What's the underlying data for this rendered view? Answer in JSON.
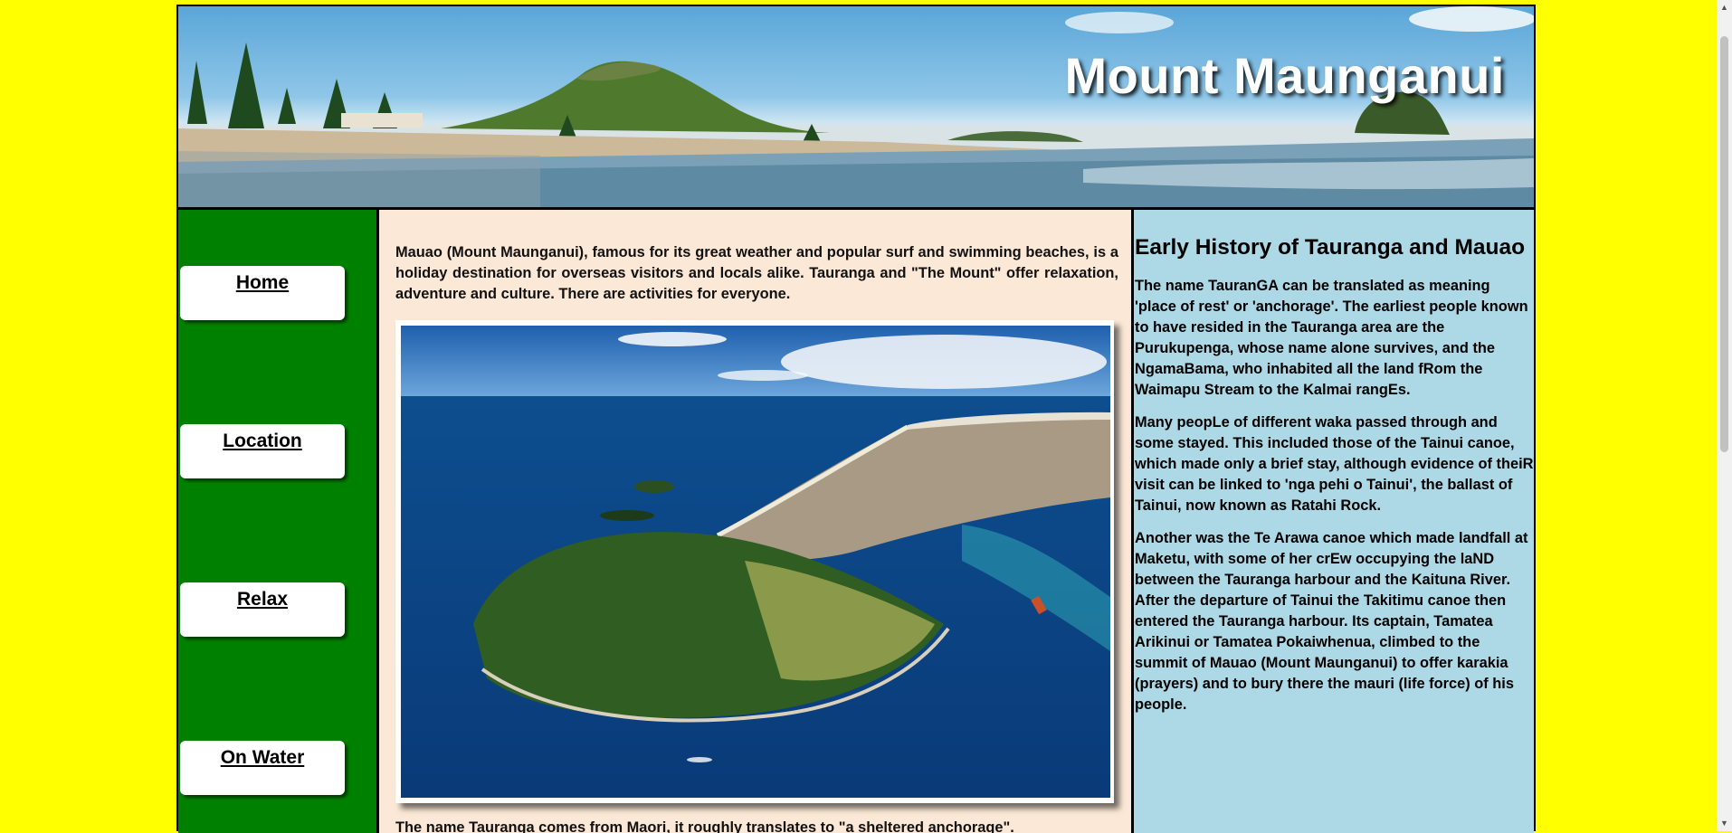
{
  "header": {
    "title": "Mount Maunganui"
  },
  "nav": {
    "items": [
      {
        "label": "Home"
      },
      {
        "label": "Location"
      },
      {
        "label": "Relax"
      },
      {
        "label": "On Water"
      }
    ]
  },
  "main": {
    "intro": "Mauao (Mount Maunganui), famous for its great weather and popular surf and swimming beaches, is a holiday destination for overseas visitors and locals alike. Tauranga and \"The Mount\" offer relaxation, adventure and culture. There are activities for everyone.",
    "bottom_text": "The name Tauranga comes from Maori, it roughly translates to \"a sheltered anchorage\"."
  },
  "history": {
    "heading": "Early History of Tauranga and Mauao",
    "paragraphs": [
      "The name TauranGA can be translated as meaning 'place of rest' or 'anchorage'. The earliest people known to have resided in the Tauranga area are the Purukupenga, whose name alone survives, and the NgamaBama, who inhabited all the land fRom the Waimapu Stream to the Kalmai rangEs.",
      "Many peopLe of different waka passed through and some stayed. This included those of the Tainui canoe, which made only a brief stay, although evidence of theiR visit can be linked to 'nga pehi o Tainui', the ballast of Tainui, now known as Ratahi Rock.",
      "Another was the Te Arawa canoe which made landfall at Maketu, with some of her crEw occupying the laND between the Tauranga harbour and the Kaituna River. After the departure of Tainui the Takitimu canoe then entered the Tauranga harbour. Its captain, Tamatea Arikinui or Tamatea Pokaiwhenua, climbed to the summit of Mauao (Mount Maunganui) to offer karakia (prayers) and to bury there the mauri (life force) of his people."
    ]
  },
  "colors": {
    "page_background": "#ffff00",
    "sidebar": "#008000",
    "main": "#fbe8d6",
    "right_panel": "#add8e6"
  }
}
